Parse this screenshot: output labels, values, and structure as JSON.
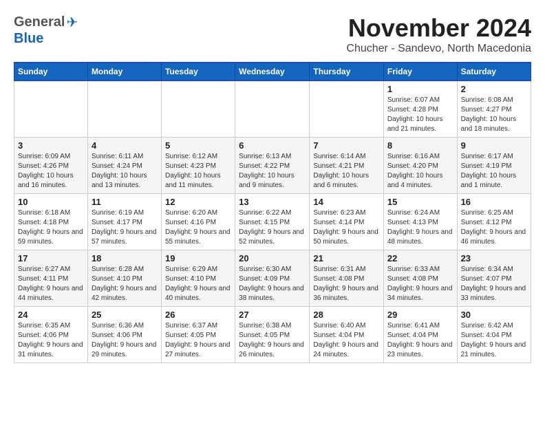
{
  "header": {
    "logo_general": "General",
    "logo_blue": "Blue",
    "month_title": "November 2024",
    "subtitle": "Chucher - Sandevo, North Macedonia"
  },
  "days_of_week": [
    "Sunday",
    "Monday",
    "Tuesday",
    "Wednesday",
    "Thursday",
    "Friday",
    "Saturday"
  ],
  "weeks": [
    {
      "days": [
        {
          "num": "",
          "info": ""
        },
        {
          "num": "",
          "info": ""
        },
        {
          "num": "",
          "info": ""
        },
        {
          "num": "",
          "info": ""
        },
        {
          "num": "",
          "info": ""
        },
        {
          "num": "1",
          "info": "Sunrise: 6:07 AM\nSunset: 4:28 PM\nDaylight: 10 hours and 21 minutes."
        },
        {
          "num": "2",
          "info": "Sunrise: 6:08 AM\nSunset: 4:27 PM\nDaylight: 10 hours and 18 minutes."
        }
      ]
    },
    {
      "days": [
        {
          "num": "3",
          "info": "Sunrise: 6:09 AM\nSunset: 4:26 PM\nDaylight: 10 hours and 16 minutes."
        },
        {
          "num": "4",
          "info": "Sunrise: 6:11 AM\nSunset: 4:24 PM\nDaylight: 10 hours and 13 minutes."
        },
        {
          "num": "5",
          "info": "Sunrise: 6:12 AM\nSunset: 4:23 PM\nDaylight: 10 hours and 11 minutes."
        },
        {
          "num": "6",
          "info": "Sunrise: 6:13 AM\nSunset: 4:22 PM\nDaylight: 10 hours and 9 minutes."
        },
        {
          "num": "7",
          "info": "Sunrise: 6:14 AM\nSunset: 4:21 PM\nDaylight: 10 hours and 6 minutes."
        },
        {
          "num": "8",
          "info": "Sunrise: 6:16 AM\nSunset: 4:20 PM\nDaylight: 10 hours and 4 minutes."
        },
        {
          "num": "9",
          "info": "Sunrise: 6:17 AM\nSunset: 4:19 PM\nDaylight: 10 hours and 1 minute."
        }
      ]
    },
    {
      "days": [
        {
          "num": "10",
          "info": "Sunrise: 6:18 AM\nSunset: 4:18 PM\nDaylight: 9 hours and 59 minutes."
        },
        {
          "num": "11",
          "info": "Sunrise: 6:19 AM\nSunset: 4:17 PM\nDaylight: 9 hours and 57 minutes."
        },
        {
          "num": "12",
          "info": "Sunrise: 6:20 AM\nSunset: 4:16 PM\nDaylight: 9 hours and 55 minutes."
        },
        {
          "num": "13",
          "info": "Sunrise: 6:22 AM\nSunset: 4:15 PM\nDaylight: 9 hours and 52 minutes."
        },
        {
          "num": "14",
          "info": "Sunrise: 6:23 AM\nSunset: 4:14 PM\nDaylight: 9 hours and 50 minutes."
        },
        {
          "num": "15",
          "info": "Sunrise: 6:24 AM\nSunset: 4:13 PM\nDaylight: 9 hours and 48 minutes."
        },
        {
          "num": "16",
          "info": "Sunrise: 6:25 AM\nSunset: 4:12 PM\nDaylight: 9 hours and 46 minutes."
        }
      ]
    },
    {
      "days": [
        {
          "num": "17",
          "info": "Sunrise: 6:27 AM\nSunset: 4:11 PM\nDaylight: 9 hours and 44 minutes."
        },
        {
          "num": "18",
          "info": "Sunrise: 6:28 AM\nSunset: 4:10 PM\nDaylight: 9 hours and 42 minutes."
        },
        {
          "num": "19",
          "info": "Sunrise: 6:29 AM\nSunset: 4:10 PM\nDaylight: 9 hours and 40 minutes."
        },
        {
          "num": "20",
          "info": "Sunrise: 6:30 AM\nSunset: 4:09 PM\nDaylight: 9 hours and 38 minutes."
        },
        {
          "num": "21",
          "info": "Sunrise: 6:31 AM\nSunset: 4:08 PM\nDaylight: 9 hours and 36 minutes."
        },
        {
          "num": "22",
          "info": "Sunrise: 6:33 AM\nSunset: 4:08 PM\nDaylight: 9 hours and 34 minutes."
        },
        {
          "num": "23",
          "info": "Sunrise: 6:34 AM\nSunset: 4:07 PM\nDaylight: 9 hours and 33 minutes."
        }
      ]
    },
    {
      "days": [
        {
          "num": "24",
          "info": "Sunrise: 6:35 AM\nSunset: 4:06 PM\nDaylight: 9 hours and 31 minutes."
        },
        {
          "num": "25",
          "info": "Sunrise: 6:36 AM\nSunset: 4:06 PM\nDaylight: 9 hours and 29 minutes."
        },
        {
          "num": "26",
          "info": "Sunrise: 6:37 AM\nSunset: 4:05 PM\nDaylight: 9 hours and 27 minutes."
        },
        {
          "num": "27",
          "info": "Sunrise: 6:38 AM\nSunset: 4:05 PM\nDaylight: 9 hours and 26 minutes."
        },
        {
          "num": "28",
          "info": "Sunrise: 6:40 AM\nSunset: 4:04 PM\nDaylight: 9 hours and 24 minutes."
        },
        {
          "num": "29",
          "info": "Sunrise: 6:41 AM\nSunset: 4:04 PM\nDaylight: 9 hours and 23 minutes."
        },
        {
          "num": "30",
          "info": "Sunrise: 6:42 AM\nSunset: 4:04 PM\nDaylight: 9 hours and 21 minutes."
        }
      ]
    }
  ]
}
